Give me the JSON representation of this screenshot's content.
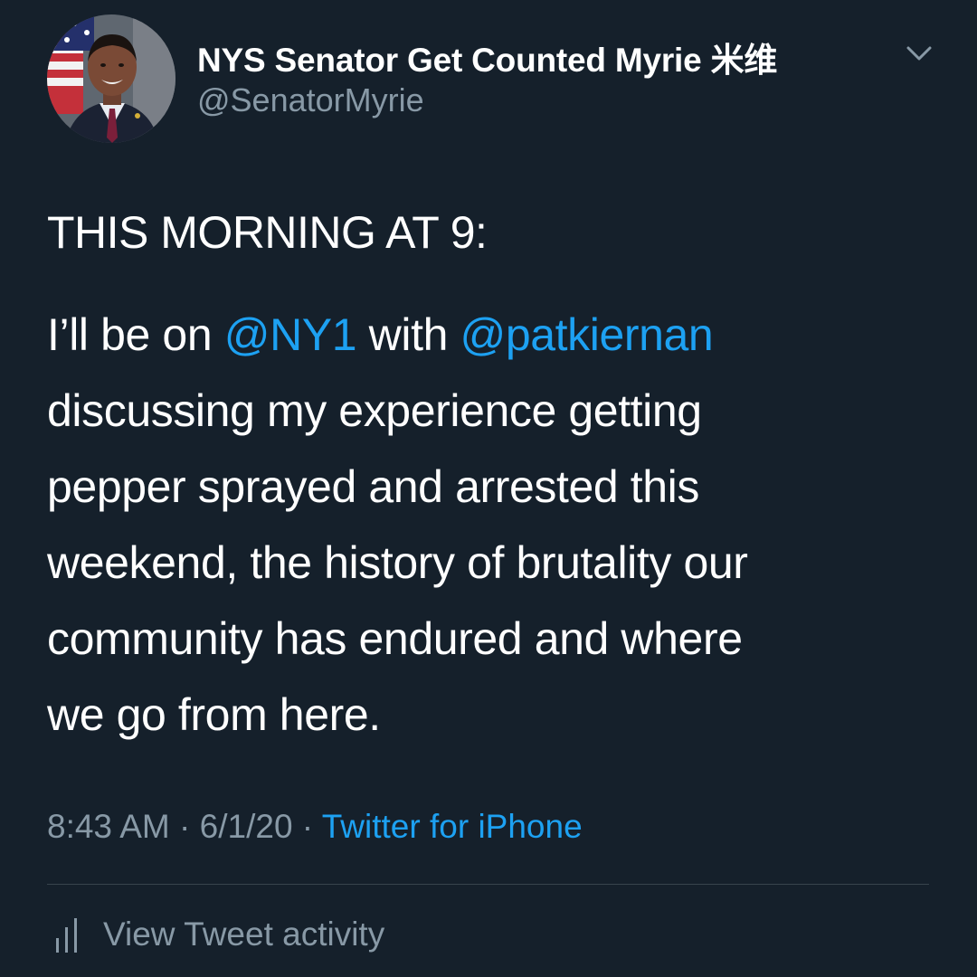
{
  "user": {
    "display_name": "NYS Senator Get Counted Myrie 米维",
    "handle": "@SenatorMyrie",
    "avatar_icon": "profile-photo"
  },
  "tweet": {
    "headline": "THIS MORNING AT 9:",
    "line1_prefix": "I’ll be on ",
    "mention1": "@NY1",
    "line1_middle": " with ",
    "mention2": "@patkiernan",
    "line2": "discussing my experience getting",
    "line3": "pepper sprayed and arrested this",
    "line4": "weekend, the history of brutality our",
    "line5": "community has endured and where",
    "line6": "we go from here."
  },
  "meta": {
    "time": "8:43 AM",
    "sep1": " · ",
    "date": "6/1/20",
    "sep2": " · ",
    "source": "Twitter for iPhone"
  },
  "activity": {
    "label": "View Tweet activity",
    "icon": "bar-chart-icon"
  },
  "colors": {
    "background": "#15202b",
    "text": "#ffffff",
    "secondary": "#8899a6",
    "link": "#1da1f2",
    "divider": "#38444d"
  }
}
